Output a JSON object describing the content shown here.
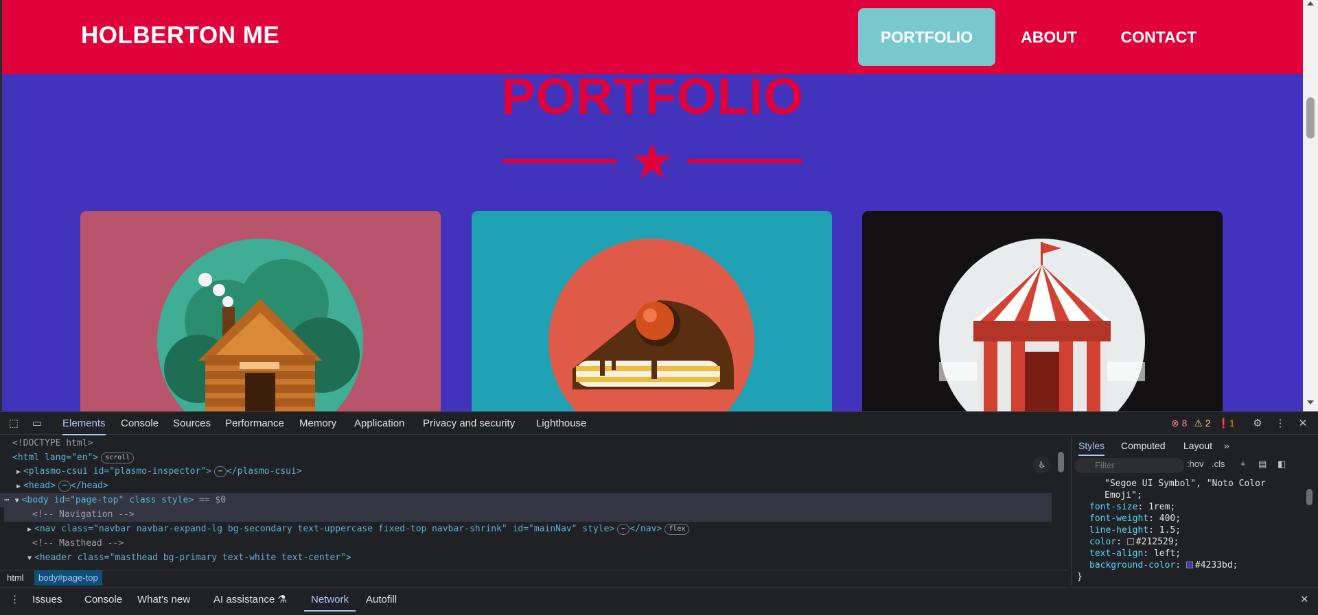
{
  "page": {
    "brand": "HOLBERTON ME",
    "nav": {
      "portfolio": "PORTFOLIO",
      "about": "ABOUT",
      "contact": "CONTACT"
    },
    "section_title": "PORTFOLIO",
    "colors": {
      "primary": "#4233bd",
      "secondary": "#e0003a",
      "active_nav": "#78c9cf"
    },
    "cards": [
      {
        "name": "cabin",
        "bg": "#b8556c"
      },
      {
        "name": "cake",
        "bg": "#20a0b3"
      },
      {
        "name": "circus",
        "bg": "#131111"
      }
    ]
  },
  "devtools": {
    "tabs": [
      "Elements",
      "Console",
      "Sources",
      "Performance",
      "Memory",
      "Application",
      "Privacy and security",
      "Lighthouse"
    ],
    "counts": {
      "errors": "8",
      "warnings": "2",
      "info": "1"
    },
    "dom": {
      "doctype": "<!DOCTYPE html>",
      "html_open": "<html lang=\"en\">",
      "scroll_pill": "scroll",
      "plasmo": "<plasmo-csui id=\"plasmo-inspector\">",
      "plasmo_close": "</plasmo-csui>",
      "head": "<head>",
      "head_close": "</head>",
      "body": "<body id=\"page-top\" class style>",
      "body_selected": "== $0",
      "comment_nav": "<!-- Navigation -->",
      "nav": "<nav class=\"navbar navbar-expand-lg bg-secondary text-uppercase fixed-top navbar-shrink\" id=\"mainNav\" style>",
      "nav_close": "</nav>",
      "flex_pill": "flex",
      "comment_masthead": "<!-- Masthead -->",
      "header": "<header class=\"masthead bg-primary text-white text-center\">"
    },
    "breadcrumb": [
      "html",
      "body#page-top"
    ],
    "styles": {
      "tabs": [
        "Styles",
        "Computed",
        "Layout"
      ],
      "filter_placeholder": "Filter",
      "hov": ":hov",
      "cls": ".cls",
      "font_family_tail_1": "\"Segoe UI Symbol\", \"Noto Color",
      "font_family_tail_2": "Emoji\";",
      "rules": [
        {
          "prop": "font-size",
          "value": "1rem;"
        },
        {
          "prop": "font-weight",
          "value": "400;"
        },
        {
          "prop": "line-height",
          "value": "1.5;"
        },
        {
          "prop": "color",
          "value": "#212529;",
          "swatch": "#212529"
        },
        {
          "prop": "text-align",
          "value": "left;"
        },
        {
          "prop": "background-color",
          "value": "#4233bd;",
          "swatch": "#4233bd"
        }
      ],
      "close_brace": "}"
    },
    "drawer_tabs": [
      "Issues",
      "Console",
      "What's new",
      "AI assistance",
      "Network",
      "Autofill"
    ]
  }
}
